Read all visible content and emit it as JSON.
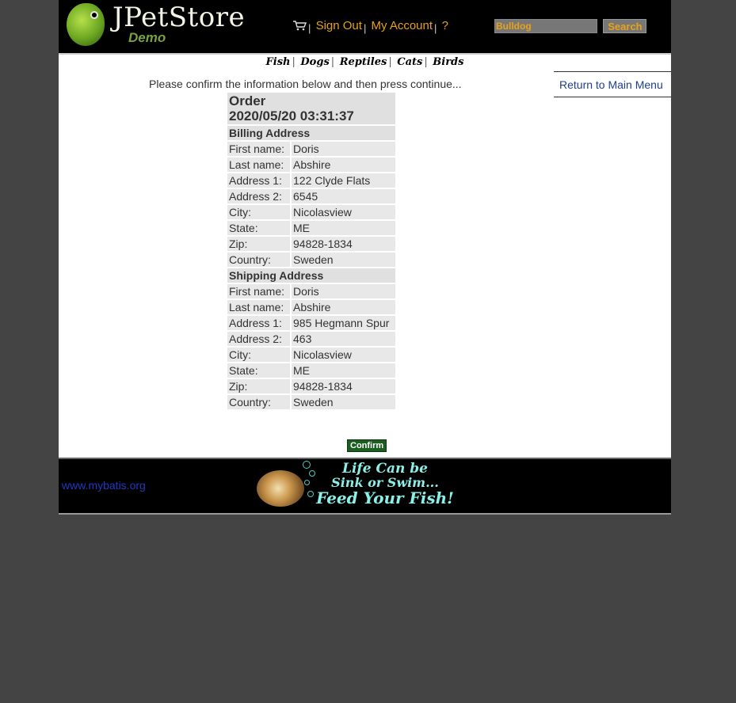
{
  "header": {
    "logo_title": "JPetStore",
    "logo_subtitle": "Demo",
    "menu": {
      "sign_out": "Sign Out",
      "my_account": "My Account",
      "help": "?"
    },
    "search": {
      "value": "Bulldog",
      "button": "Search"
    }
  },
  "quicklinks": [
    "Fish",
    "Dogs",
    "Reptiles",
    "Cats",
    "Birds"
  ],
  "sidebar": {
    "return_link": "Return to Main Menu"
  },
  "main": {
    "message": "Please confirm the information below and then press continue...",
    "order_title": "Order",
    "order_date": "2020/05/20 03:31:37",
    "billing": {
      "title": "Billing Address",
      "rows": [
        {
          "label": "First name:",
          "value": "Doris"
        },
        {
          "label": "Last name:",
          "value": "Abshire"
        },
        {
          "label": "Address 1:",
          "value": "122 Clyde Flats"
        },
        {
          "label": "Address 2:",
          "value": "6545"
        },
        {
          "label": "City:",
          "value": "Nicolasview"
        },
        {
          "label": "State:",
          "value": "ME"
        },
        {
          "label": "Zip:",
          "value": "94828-1834"
        },
        {
          "label": "Country:",
          "value": "Sweden"
        }
      ]
    },
    "shipping": {
      "title": "Shipping Address",
      "rows": [
        {
          "label": "First name:",
          "value": "Doris"
        },
        {
          "label": "Last name:",
          "value": "Abshire"
        },
        {
          "label": "Address 1:",
          "value": "985 Hegmann Spur"
        },
        {
          "label": "Address 2:",
          "value": "463"
        },
        {
          "label": "City:",
          "value": "Nicolasview"
        },
        {
          "label": "State:",
          "value": "ME"
        },
        {
          "label": "Zip:",
          "value": "94828-1834"
        },
        {
          "label": "Country:",
          "value": "Sweden"
        }
      ]
    },
    "confirm_button": "Confirm"
  },
  "footer": {
    "link": "www.mybatis.org",
    "banner_lines": [
      "Life Can be",
      "Sink or Swim...",
      "Feed Your Fish!"
    ]
  },
  "colors": {
    "page_bg": "#444444",
    "header_bg": "#000000",
    "menu_link": "#e8a215",
    "link_blue": "#1e3f8c",
    "confirm_bg": "#1b5e20"
  },
  "icons": {
    "cart": "shopping-cart-icon",
    "logo": "parrot-logo-icon"
  }
}
